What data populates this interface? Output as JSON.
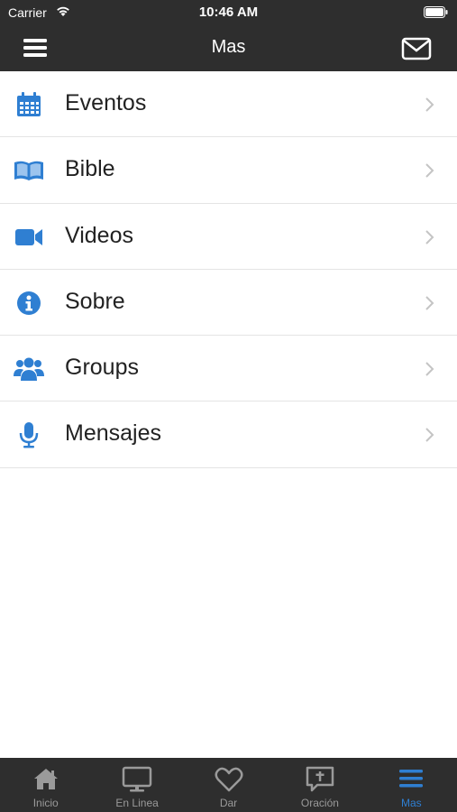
{
  "status_bar": {
    "carrier": "Carrier",
    "time": "10:46 AM"
  },
  "nav": {
    "title": "Mas",
    "menu_icon": "hamburger-icon",
    "mail_icon": "envelope-icon"
  },
  "accent_color": "#2f7fd2",
  "items": [
    {
      "label": "Eventos",
      "icon": "calendar-icon"
    },
    {
      "label": "Bible",
      "icon": "open-book-icon"
    },
    {
      "label": "Videos",
      "icon": "video-camera-icon"
    },
    {
      "label": "Sobre",
      "icon": "info-icon"
    },
    {
      "label": "Groups",
      "icon": "users-icon"
    },
    {
      "label": "Mensajes",
      "icon": "microphone-icon"
    }
  ],
  "tabs": [
    {
      "label": "Inicio",
      "icon": "home-icon",
      "active": false
    },
    {
      "label": "En Linea",
      "icon": "monitor-icon",
      "active": false
    },
    {
      "label": "Dar",
      "icon": "heart-icon",
      "active": false
    },
    {
      "label": "Oración",
      "icon": "prayer-bubble-icon",
      "active": false
    },
    {
      "label": "Mas",
      "icon": "menu-icon",
      "active": true
    }
  ]
}
